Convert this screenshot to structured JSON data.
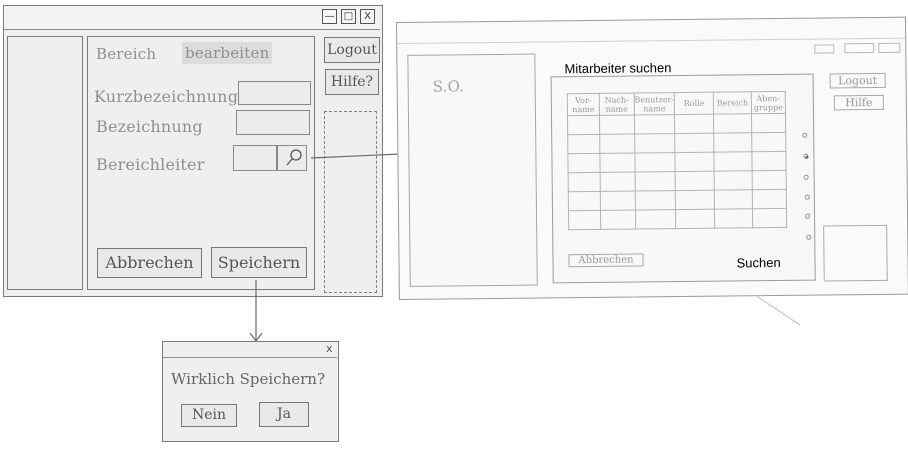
{
  "main_window": {
    "controls": {
      "minimize": "—",
      "maximize": "□",
      "close": "X"
    },
    "title": "Bereich bearbeiten",
    "title_part1": "Bereich",
    "title_part2": "bearbeiten",
    "fields": [
      {
        "label": "Kurzbezeichnung",
        "value": ""
      },
      {
        "label": "Bezeichnung",
        "value": ""
      },
      {
        "label": "Bereichleiter",
        "value": ""
      }
    ],
    "buttons": {
      "cancel": "Abbrechen",
      "save": "Speichern",
      "logout": "Logout",
      "help": "Hilfe?"
    },
    "search_icon": "magnifier-icon"
  },
  "search_window": {
    "title": "Mitarbeiter suchen",
    "left_panel_text": "S.O.",
    "buttons": {
      "logout": "Logout",
      "help": "Hilfe",
      "cancel": "Abbrechen",
      "search": "Suchen"
    },
    "table": {
      "headers": [
        "Vor-name",
        "Nach-name",
        "Benutzer-name",
        "Rolle",
        "Bereich",
        "Aben-gruppe"
      ],
      "rows": 6
    },
    "selected_row": 1
  },
  "dialog": {
    "close": "x",
    "message": "Wirklich Speichern?",
    "buttons": {
      "no": "Nein",
      "yes": "Ja"
    }
  }
}
